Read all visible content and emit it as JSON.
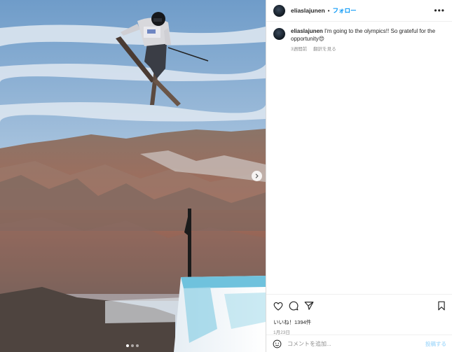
{
  "post": {
    "username": "eliaslajunen",
    "separator": "•",
    "follow_label": "フォロー",
    "more_label": "•••",
    "caption_username": "eliaslajunen",
    "caption_text": " I'm going to the olympics!! So grateful for the opportunity😍",
    "time_ago": "3週間前",
    "translate_label": "翻訳を見る",
    "likes_text": "いいね！1394件",
    "date_text": "1月23日",
    "comment_placeholder": "コメントを追加...",
    "post_button_label": "投稿する"
  },
  "media": {
    "carousel_total": 3,
    "carousel_active": 1,
    "next_icon": "chevron-right-icon"
  },
  "icons": {
    "like": "heart-icon",
    "comment": "comment-icon",
    "share": "paper-plane-icon",
    "save": "bookmark-icon",
    "emoji": "smiley-icon"
  },
  "colors": {
    "link_blue": "#0095f6",
    "post_disabled_blue": "#b2dffc",
    "meta_gray": "#8e8e8e",
    "text_dark": "#262626"
  }
}
